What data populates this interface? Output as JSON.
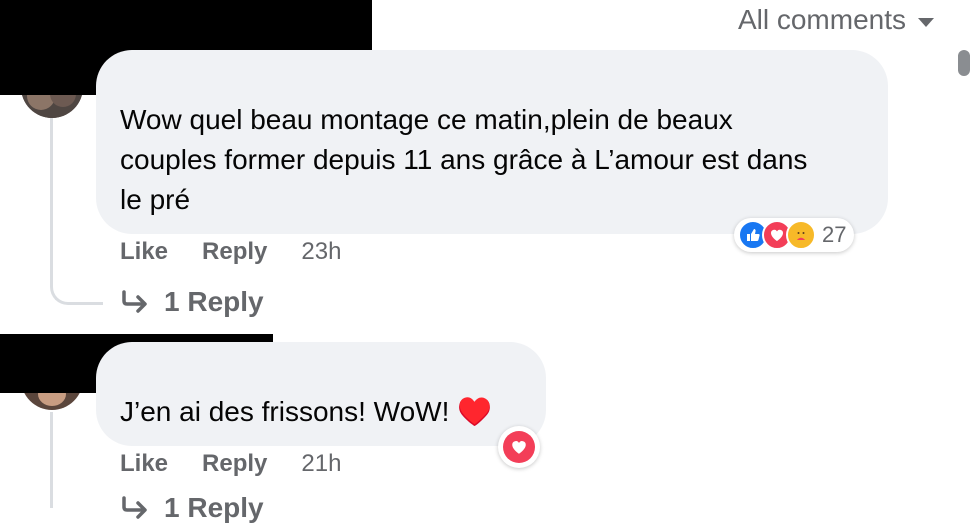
{
  "header": {
    "filter_label": "All comments",
    "filter_icon": "caret-down-icon"
  },
  "comments": [
    {
      "text": "Wow quel beau montage ce matin,plein de beaux couples former depuis 11 ans grâce à L’amour est dans le pré",
      "like_label": "Like",
      "reply_label": "Reply",
      "time": "23h",
      "reactions": {
        "icons": [
          "like-icon",
          "love-icon",
          "care-icon"
        ],
        "count": "27"
      },
      "replies_label": "1 Reply"
    },
    {
      "text": "J’en ai des frissons! WoW! ♥️",
      "like_label": "Like",
      "reply_label": "Reply",
      "time": "21h",
      "reactions": {
        "icons": [
          "love-icon"
        ]
      },
      "replies_label": "1 Reply"
    }
  ],
  "colors": {
    "bubble": "#f0f2f5",
    "secondary_text": "#65676b",
    "like_blue": "#1877f2",
    "love_red": "#f33e58",
    "care_yellow": "#f7b928"
  }
}
